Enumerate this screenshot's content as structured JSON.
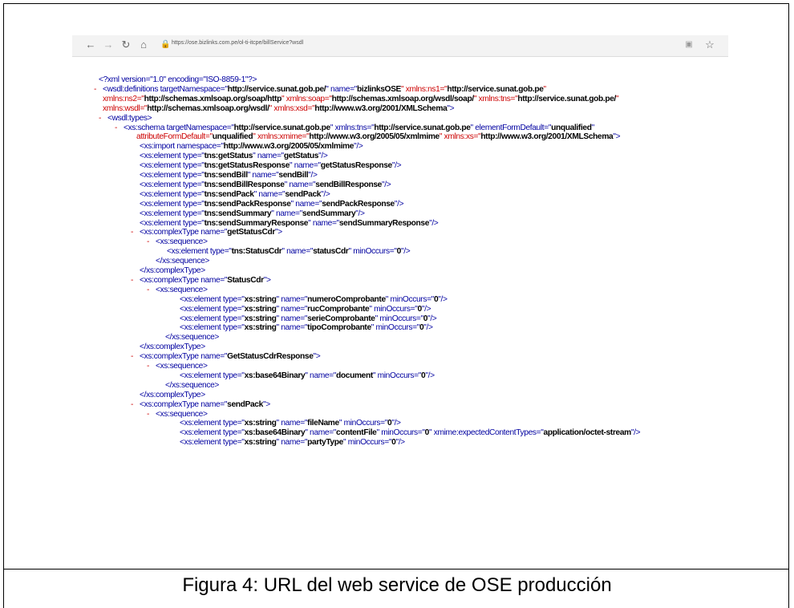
{
  "browser": {
    "url": "https://ose.bizlinks.com.pe/ol-ti-itcpe/billService?wsdl"
  },
  "caption": "Figura 4: URL del web service de OSE producción",
  "xml": {
    "line1": "<?xml version=\"1.0\" encoding=\"ISO-8859-1\"?>",
    "l_definitions_1": "<wsdl:definitions targetNamespace=\"",
    "v_tns": "http://service.sunat.gob.pe/",
    "l_name": "\" name=\"",
    "v_bizlinks": "bizlinksOSE",
    "l_ns1": "\" xmlns:ns1=\"",
    "v_ns1": "http://service.sunat.gob.pe",
    "l_q": "\"",
    "l_ns2": "xmlns:ns2=\"",
    "v_ns2": "http://schemas.xmlsoap.org/soap/http",
    "l_soap": "\" xmlns:soap=\"",
    "v_soap": "http://schemas.xmlsoap.org/wsdl/soap/",
    "l_tns": "\" xmlns:tns=\"",
    "v_tns2": "http://service.sunat.gob.pe/",
    "l_q2": "\"",
    "l_wsdl": "xmlns:wsdl=\"",
    "v_wsdl": "http://schemas.xmlsoap.org/wsdl/",
    "l_xsd": "\" xmlns:xsd=\"",
    "v_xsd": "http://www.w3.org/2001/XMLSchema",
    "l_end": "\">",
    "types": "<wsdl:types>",
    "schema_1": "<xs:schema targetNamespace=\"",
    "v_schema_tns": "http://service.sunat.gob.pe",
    "schema_2": "\" xmlns:tns=\"",
    "v_schema_tns2": "http://service.sunat.gob.pe",
    "schema_3": "\" elementFormDefault=\"",
    "v_unqualified": "unqualified",
    "schema_4": "\"",
    "schema_5": "attributeFormDefault=\"",
    "v_unqualified2": "unqualified",
    "schema_6": "\" xmlns:xmime=\"",
    "v_xmime": "http://www.w3.org/2005/05/xmlmime",
    "schema_7": "\" xmlns:xs=\"",
    "v_xs": "http://www.w3.org/2001/XMLSchema",
    "schema_8": "\">",
    "import_1": "<xs:import namespace=\"",
    "v_import": "http://www.w3.org/2005/05/xmlmime",
    "import_2": "\"/>",
    "elements": [
      {
        "type": "tns:getStatus",
        "name": "getStatus"
      },
      {
        "type": "tns:getStatusResponse",
        "name": "getStatusResponse"
      },
      {
        "type": "tns:sendBill",
        "name": "sendBill"
      },
      {
        "type": "tns:sendBillResponse",
        "name": "sendBillResponse"
      },
      {
        "type": "tns:sendPack",
        "name": "sendPack"
      },
      {
        "type": "tns:sendPackResponse",
        "name": "sendPackResponse"
      },
      {
        "type": "tns:sendSummary",
        "name": "sendSummary"
      },
      {
        "type": "tns:sendSummaryResponse",
        "name": "sendSummaryResponse"
      }
    ],
    "ct_getStatusCdr": "getStatusCdr",
    "e_statusCdr_type": "tns:StatusCdr",
    "e_statusCdr_name": "statusCdr",
    "zero": "0",
    "ct_StatusCdr": "StatusCdr",
    "statusCdr_fields": [
      {
        "type": "xs:string",
        "name": "numeroComprobante"
      },
      {
        "type": "xs:string",
        "name": "rucComprobante"
      },
      {
        "type": "xs:string",
        "name": "serieComprobante"
      },
      {
        "type": "xs:string",
        "name": "tipoComprobante"
      }
    ],
    "ct_GetStatusCdrResponse": "GetStatusCdrResponse",
    "e_document_type": "xs:base64Binary",
    "e_document_name": "document",
    "ct_sendPack": "sendPack",
    "e_fileName_type": "xs:string",
    "e_fileName_name": "fileName",
    "e_contentFile_type": "xs:base64Binary",
    "e_contentFile_name": "contentFile",
    "e_contentFile_mime": "application/octet-stream",
    "e_partyType_type": "xs:string",
    "e_partyType_name": "partyType",
    "s_complex_open": "<xs:complexType name=\"",
    "s_complex_close": "</xs:complexType>",
    "s_seq_open": "<xs:sequence>",
    "s_seq_close": "</xs:sequence>",
    "s_el_type": "<xs:element type=\"",
    "s_el_name": "\" name=\"",
    "s_el_min": "\" minOccurs=\"",
    "s_el_end": "\"/>",
    "s_tag_end": "\">",
    "s_xmime": "\" xmime:expectedContentTypes=\"",
    "dash": "-"
  }
}
